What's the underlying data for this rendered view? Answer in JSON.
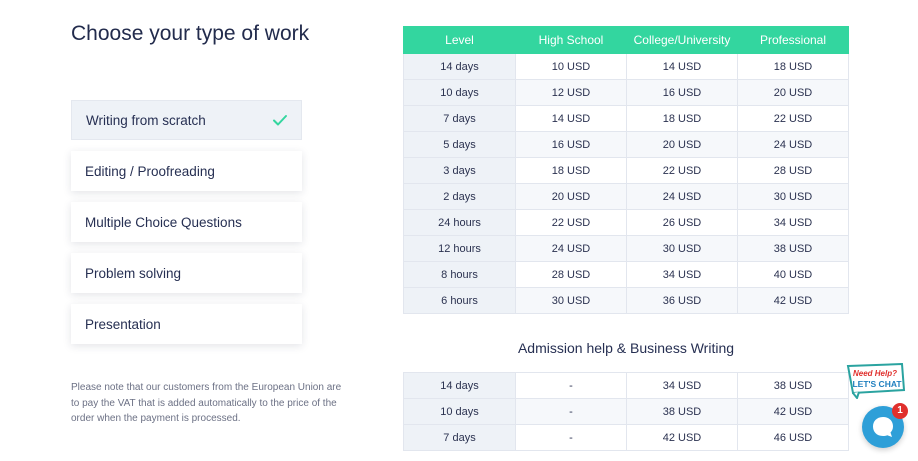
{
  "heading": "Choose your type of work",
  "work_types": [
    {
      "label": "Writing from scratch",
      "selected": true
    },
    {
      "label": "Editing / Proofreading",
      "selected": false
    },
    {
      "label": "Multiple Choice Questions",
      "selected": false
    },
    {
      "label": "Problem solving",
      "selected": false
    },
    {
      "label": "Presentation",
      "selected": false
    }
  ],
  "vat_note": "Please note that our customers from the European Union are to pay the VAT that is added automatically to the price of the order when the payment is processed.",
  "price_table": {
    "headers": [
      "Level",
      "High School",
      "College/University",
      "Professional"
    ],
    "rows": [
      [
        "14 days",
        "10 USD",
        "14 USD",
        "18 USD"
      ],
      [
        "10 days",
        "12 USD",
        "16 USD",
        "20 USD"
      ],
      [
        "7 days",
        "14 USD",
        "18 USD",
        "22 USD"
      ],
      [
        "5 days",
        "16 USD",
        "20 USD",
        "24 USD"
      ],
      [
        "3 days",
        "18 USD",
        "22 USD",
        "28 USD"
      ],
      [
        "2 days",
        "20 USD",
        "24 USD",
        "30 USD"
      ],
      [
        "24 hours",
        "22 USD",
        "26 USD",
        "34 USD"
      ],
      [
        "12 hours",
        "24 USD",
        "30 USD",
        "38 USD"
      ],
      [
        "8 hours",
        "28 USD",
        "34 USD",
        "40 USD"
      ],
      [
        "6 hours",
        "30 USD",
        "36 USD",
        "42 USD"
      ]
    ]
  },
  "admission_section": {
    "title": "Admission help & Business Writing",
    "rows": [
      [
        "14 days",
        "-",
        "34 USD",
        "38 USD"
      ],
      [
        "10 days",
        "-",
        "38 USD",
        "42 USD"
      ],
      [
        "7 days",
        "-",
        "42 USD",
        "46 USD"
      ]
    ]
  },
  "chat_widget": {
    "badge_line1": "Need Help?",
    "badge_line2": "LET'S CHAT",
    "unread_count": "1"
  },
  "colors": {
    "accent": "#33d69f",
    "chat_blue": "#2e9fd8",
    "badge_red": "#e0302d"
  }
}
